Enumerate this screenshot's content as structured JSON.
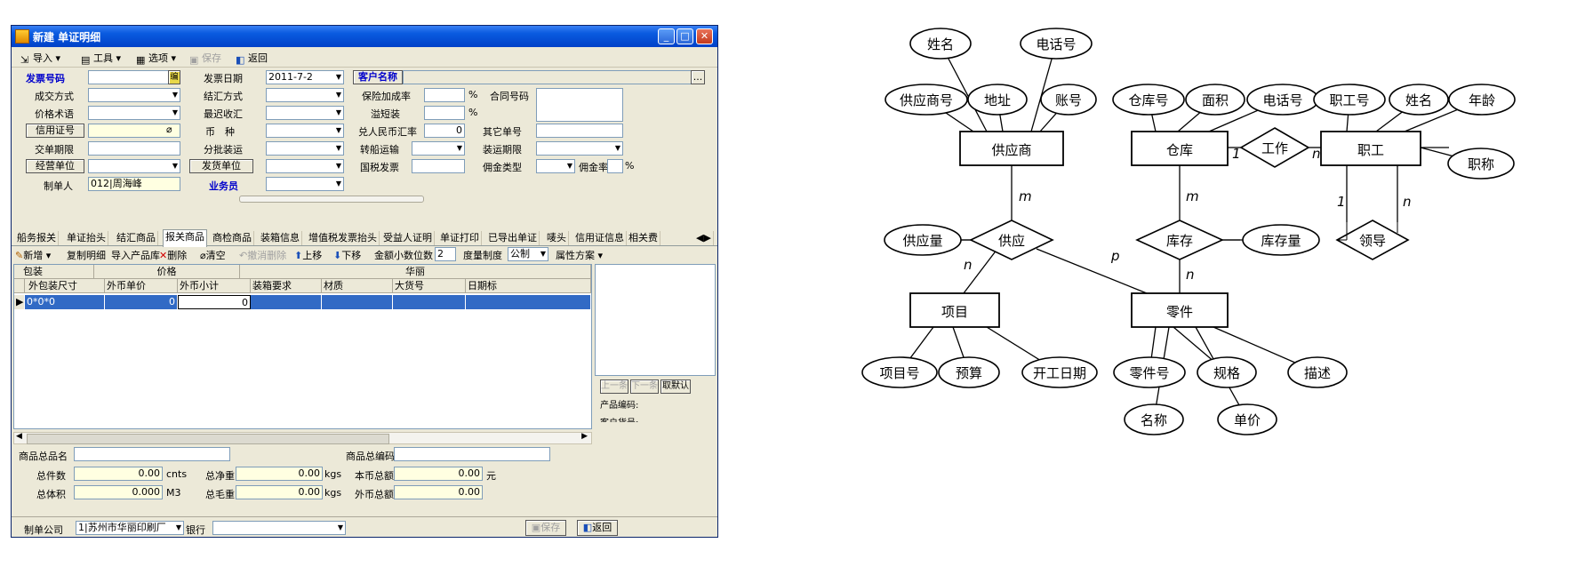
{
  "window": {
    "title": "新建 单证明细",
    "toolbar": {
      "import": "导入",
      "tools": "工具",
      "options": "选项",
      "save": "保存",
      "back": "返回"
    },
    "form": {
      "invoice_no_label": "发票号码",
      "invoice_no_btn": "编",
      "invoice_date_label": "发票日期",
      "invoice_date_value": "2011-7-2",
      "customer_name_label": "客户名称",
      "customer_more": "...",
      "deal_mode_label": "成交方式",
      "settle_mode_label": "结汇方式",
      "insurance_rate_label": "保险加成率",
      "percent": "%",
      "contract_no_label": "合同号码",
      "price_term_label": "价格术语",
      "latest_receipt_label": "最迟收汇",
      "overflow_label": "溢短装",
      "credit_no_label": "信用证号",
      "currency_label": "币　种",
      "cny_rate_label": "兑人民币汇率",
      "cny_rate_value": "0",
      "other_no_label": "其它单号",
      "delivery_term_label": "交单期限",
      "partial_ship_label": "分批装运",
      "transship_label": "转船运输",
      "ship_term_label": "装运期限",
      "operator_unit_label": "经营单位",
      "shipper_unit_label": "发货单位",
      "tax_refund_label": "国税发票",
      "commission_type_label": "佣金类型",
      "commission_rate_label": "佣金率",
      "maker_label": "制单人",
      "maker_value": "012|周海峰",
      "salesman_label": "业务员"
    },
    "tabs": [
      "船务报关",
      "单证抬头",
      "结汇商品",
      "报关商品",
      "商检商品",
      "装箱信息",
      "增值税发票抬头",
      "受益人证明",
      "单证打印",
      "已导出单证",
      "唛头",
      "信用证信息",
      "相关费"
    ],
    "active_tab": "报关商品",
    "subtoolbar": {
      "add": "新增",
      "copy": "复制明细",
      "import_lib": "导入产品库",
      "delete": "删除",
      "clear": "清空",
      "undo_delete": "撤消删除",
      "up": "上移",
      "down": "下移",
      "decimal_label": "金额小数位数",
      "decimal_value": "2",
      "measure_label": "度量制度",
      "measure_value": "公制",
      "attr_plan": "属性方案"
    },
    "grid": {
      "group_headers": [
        "包装",
        "价格",
        "华丽"
      ],
      "columns": [
        "外包装尺寸",
        "外币单价",
        "外币小计",
        "装箱要求",
        "材质",
        "大货号",
        "日期标"
      ],
      "row": [
        "0*0*0",
        "0",
        "0",
        "",
        "",
        "",
        ""
      ]
    },
    "side": {
      "prev": "上一条",
      "next": "下一条",
      "default": "取默认",
      "product_code": "产品编码:",
      "customer_code": "客户货号:"
    },
    "summary": {
      "product_name_label": "商品总品名",
      "product_code_label": "商品总编码",
      "total_pieces_label": "总件数",
      "total_pieces_value": "0.00",
      "pieces_unit": "cnts",
      "net_weight_label": "总净重",
      "net_weight_value": "0.00",
      "kgs1": "kgs",
      "local_total_label": "本币总额",
      "local_total_value": "0.00",
      "yuan": "元",
      "volume_label": "总体积",
      "volume_value": "0.000",
      "m3": "M3",
      "gross_weight_label": "总毛重",
      "gross_weight_value": "0.00",
      "kgs2": "kgs",
      "foreign_total_label": "外币总额",
      "foreign_total_value": "0.00"
    },
    "footer": {
      "company_label": "制单公司",
      "company_value": "1|苏州市华丽印刷厂",
      "bank_label": "银行",
      "save": "保存",
      "back": "返回"
    }
  },
  "er_diagram": {
    "entities": [
      "供应商",
      "仓库",
      "职工",
      "项目",
      "零件"
    ],
    "relations": [
      "供应",
      "库存",
      "工作",
      "领导"
    ],
    "attributes": [
      "姓名",
      "电话号",
      "供应商号",
      "地址",
      "账号",
      "仓库号",
      "面积",
      "电话号",
      "职工号",
      "姓名",
      "年龄",
      "职称",
      "供应量",
      "库存量",
      "项目号",
      "预算",
      "开工日期",
      "零件号",
      "规格",
      "描述",
      "名称",
      "单价"
    ],
    "cardinalities": [
      "m",
      "n",
      "p",
      "m",
      "n",
      "1",
      "n",
      "1",
      "n"
    ]
  }
}
